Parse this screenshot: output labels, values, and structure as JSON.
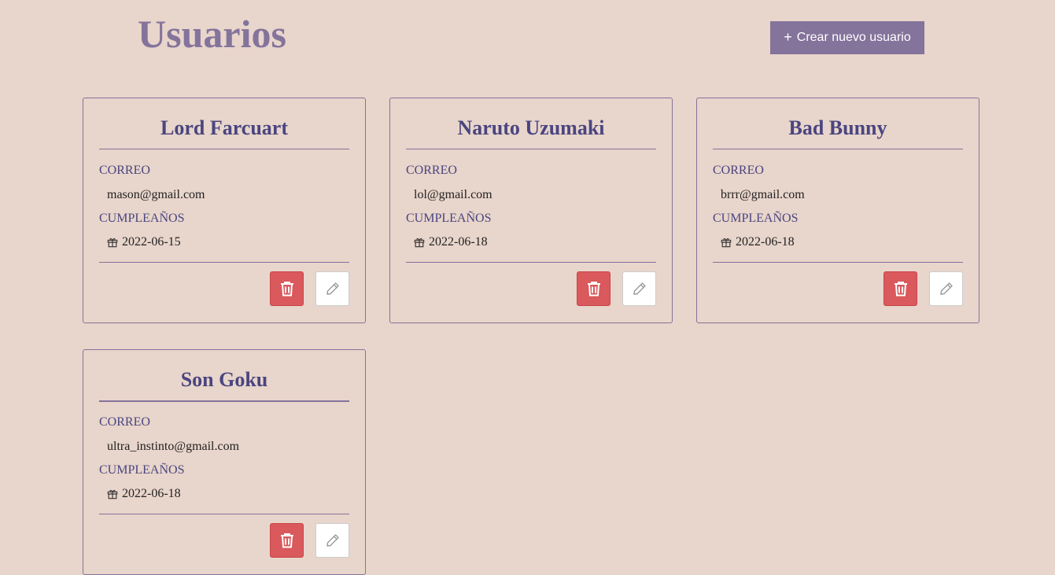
{
  "header": {
    "title": "Usuarios",
    "create_button_icon": "+",
    "create_button_label": "Crear nuevo usuario"
  },
  "cards": [
    {
      "name": "Lord Farcuart",
      "email_label": "CORREO",
      "email": "mason@gmail.com",
      "birthday_label": "CUMPLEAÑOS",
      "birthday": "2022-06-15"
    },
    {
      "name": "Naruto Uzumaki",
      "email_label": "CORREO",
      "email": "lol@gmail.com",
      "birthday_label": "CUMPLEAÑOS",
      "birthday": "2022-06-18"
    },
    {
      "name": "Bad Bunny",
      "email_label": "CORREO",
      "email": "brrr@gmail.com",
      "birthday_label": "CUMPLEAÑOS",
      "birthday": "2022-06-18"
    },
    {
      "name": "Son Goku",
      "email_label": "CORREO",
      "email": "ultra_instinto@gmail.com",
      "birthday_label": "CUMPLEAÑOS",
      "birthday": "2022-06-18"
    }
  ],
  "icons": {
    "birthday": "gift-icon",
    "delete": "trash-icon",
    "edit": "pencil-icon"
  },
  "colors": {
    "background": "#e8d5cb",
    "accent": "#84739b",
    "card_text": "#4a4580",
    "delete_button": "#d9595c",
    "edit_button": "#ffffff"
  }
}
